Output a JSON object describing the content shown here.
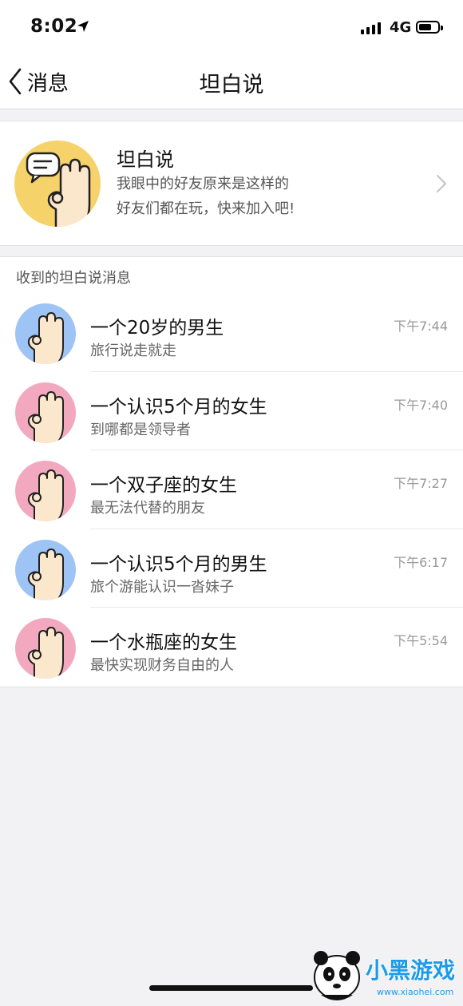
{
  "status_bar": {
    "time": "8:02",
    "network": "4G",
    "icons": [
      "location-arrow-icon",
      "signal-icon",
      "battery-icon"
    ]
  },
  "nav": {
    "back_label": "消息",
    "title": "坦白说"
  },
  "promo": {
    "title": "坦白说",
    "line1": "我眼中的好友原来是这样的",
    "line2": "好友们都在玩，快来加入吧!",
    "avatar_color": "#f6d26a"
  },
  "section": {
    "header": "收到的坦白说消息"
  },
  "messages": [
    {
      "title": "一个20岁的男生",
      "subtitle": "旅行说走就走",
      "time": "下午7:44",
      "avatar_color": "#9ec3f5"
    },
    {
      "title": "一个认识5个月的女生",
      "subtitle": "到哪都是领导者",
      "time": "下午7:40",
      "avatar_color": "#f2a9c0"
    },
    {
      "title": "一个双子座的女生",
      "subtitle": "最无法代替的朋友",
      "time": "下午7:27",
      "avatar_color": "#f2a9c0"
    },
    {
      "title": "一个认识5个月的男生",
      "subtitle": "旅个游能认识一沓妹子",
      "time": "下午6:17",
      "avatar_color": "#9ec3f5"
    },
    {
      "title": "一个水瓶座的女生",
      "subtitle": "最快实现财务自由的人",
      "time": "下午5:54",
      "avatar_color": "#f2a9c0"
    }
  ],
  "watermark": {
    "text": "小黑游戏",
    "url_text": "www.xiaohei.com"
  }
}
